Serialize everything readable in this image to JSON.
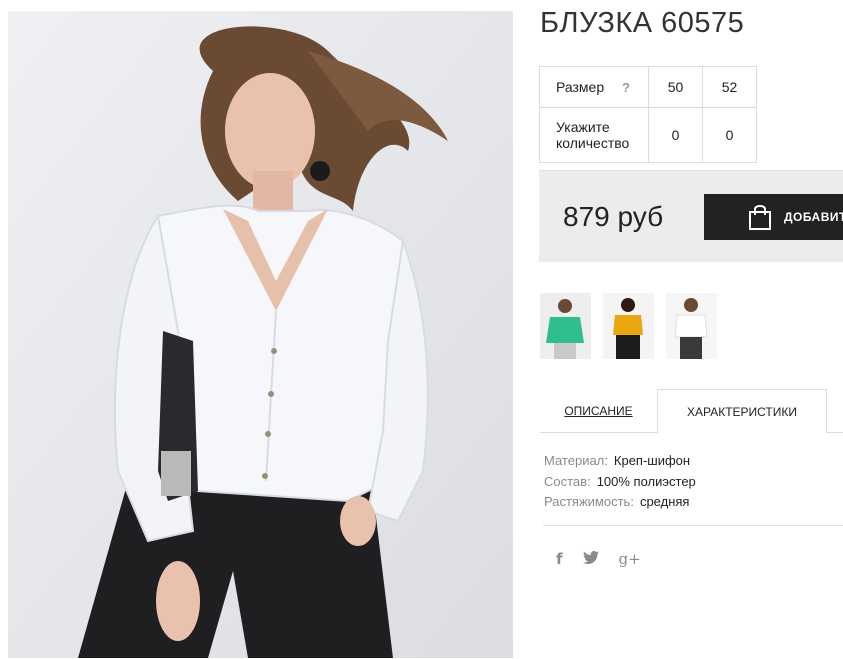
{
  "product": {
    "title": "БЛУЗКА 60575",
    "image_alt": "white blouse product photo"
  },
  "size_table": {
    "size_label": "Размер",
    "help_symbol": "?",
    "sizes": [
      "50",
      "52"
    ],
    "quantity_label": "Укажите количество",
    "quantities": [
      "0",
      "0"
    ]
  },
  "purchase": {
    "price": "879 руб",
    "add_button_label": "ДОБАВИТ",
    "add_icon": "shopping-bag-icon"
  },
  "thumbnails": [
    {
      "name": "green-blouse-thumbnail",
      "color": "#2fbf8f"
    },
    {
      "name": "yellow-blouse-thumbnail",
      "color": "#e8a60f"
    },
    {
      "name": "white-blouse-thumbnail",
      "color": "#f4f4f4"
    }
  ],
  "tabs": {
    "description": "ОПИСАНИЕ",
    "characteristics": "ХАРАКТЕРИСТИКИ",
    "active": "characteristics"
  },
  "specs": [
    {
      "key": "Материал:",
      "value": "Креп-шифон"
    },
    {
      "key": "Состав:",
      "value": "100% полиэстер"
    },
    {
      "key": "Растяжимость:",
      "value": "средняя"
    }
  ],
  "social": {
    "facebook": "f",
    "twitter": "🐦",
    "google_plus": "g+"
  },
  "colors": {
    "button_bg": "#222222",
    "price_box_bg": "#ececec",
    "border": "#dcdcdc",
    "muted_text": "#8a8a8a"
  }
}
